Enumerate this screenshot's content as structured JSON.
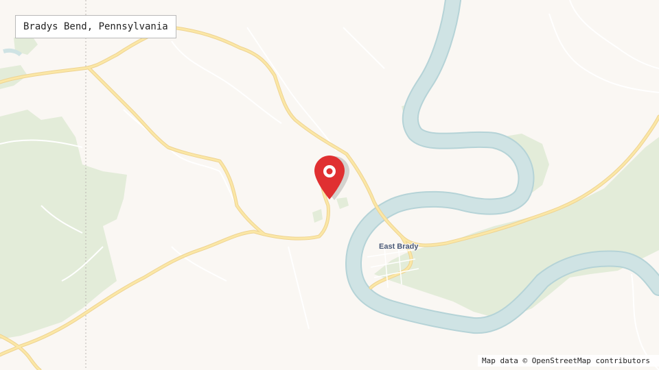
{
  "map": {
    "place_title": "Bradys Bend, Pennsylvania",
    "town_label": "East Brady",
    "attribution": "Map data © OpenStreetMap contributors",
    "marker": {
      "icon": "map-pin-icon",
      "color": "#e03031"
    },
    "colors": {
      "background": "#faf7f3",
      "water": "#cfe3e4",
      "water_outline": "#b5d3d7",
      "forest": "#e3ecd9",
      "road_major": "#fbe7a6",
      "road_major_outline": "#eed391",
      "road_minor": "#ffffff",
      "boundary": "#b9b4b0"
    }
  }
}
